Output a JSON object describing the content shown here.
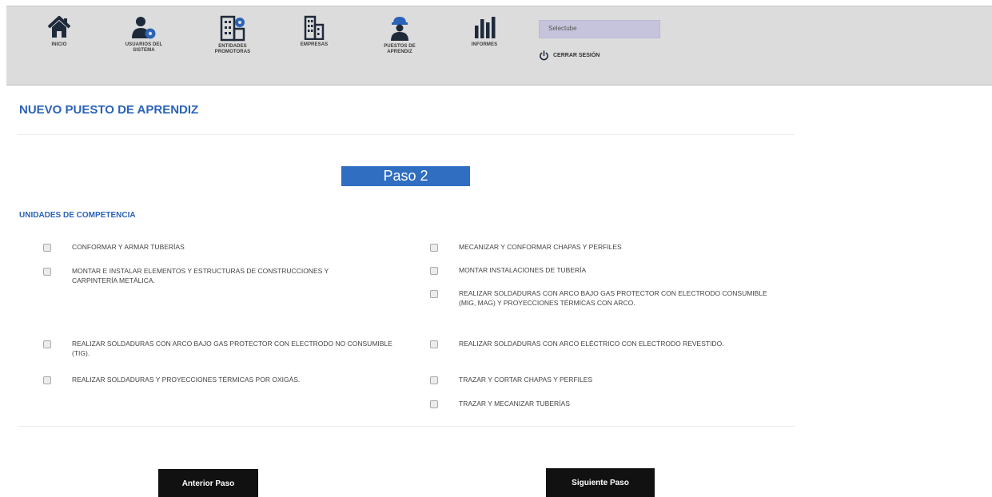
{
  "nav": {
    "items": [
      {
        "id": "inicio",
        "label": "INICIO",
        "icon": "home-icon"
      },
      {
        "id": "usuarios",
        "label": "USUARIOS DEL SISTEMA",
        "icon": "user-gear-icon"
      },
      {
        "id": "entidades",
        "label": "ENTIDADES PROMOTORAS",
        "icon": "building-gear-icon"
      },
      {
        "id": "empresas",
        "label": "EMPRESAS",
        "icon": "buildings-icon"
      },
      {
        "id": "puestos",
        "label": "PUESTOS DE APRENDIZ",
        "icon": "worker-helmet-icon"
      },
      {
        "id": "informes",
        "label": "INFORMES",
        "icon": "bar-chart-icon"
      }
    ],
    "user_select": "Selectube",
    "logout_label": "CERRAR SESIÓN"
  },
  "page": {
    "title": "NUEVO PUESTO DE APRENDIZ",
    "step": "Paso 2",
    "section_title": "UNIDADES DE COMPETENCIA"
  },
  "competencias": [
    {
      "label": "CONFORMAR Y ARMAR TUBERÍAS",
      "checked": false
    },
    {
      "label": "MONTAR E INSTALAR ELEMENTOS Y ESTRUCTURAS DE CONSTRUCCIONES Y CARPINTERÍA METÁLICA.",
      "checked": false
    },
    {
      "label": "REALIZAR SOLDADURAS CON ARCO BAJO GAS PROTECTOR CON ELECTRODO NO CONSUMIBLE (TIG).",
      "checked": false
    },
    {
      "label": "REALIZAR SOLDADURAS Y PROYECCIONES TÉRMICAS POR OXIGÁS.",
      "checked": false
    },
    {
      "label": "MECANIZAR Y CONFORMAR CHAPAS Y PERFILES",
      "checked": false
    },
    {
      "label": "MONTAR INSTALACIONES DE TUBERÍA",
      "checked": false
    },
    {
      "label": "REALIZAR SOLDADURAS CON ARCO BAJO GAS PROTECTOR CON ELECTRODO CONSUMIBLE (MIG, MAG) Y PROYECCIONES TÉRMICAS CON ARCO.",
      "checked": false
    },
    {
      "label": "REALIZAR SOLDADURAS CON ARCO ELÉCTRICO CON ELECTRODO REVESTIDO.",
      "checked": false
    },
    {
      "label": "TRAZAR Y CORTAR CHAPAS Y PERFILES",
      "checked": false
    },
    {
      "label": "TRAZAR Y MECANIZAR TUBERÍAS",
      "checked": false
    }
  ],
  "buttons": {
    "prev": "Anterior Paso",
    "next": "Siguiente Paso"
  },
  "colors": {
    "accent": "#2b63b8",
    "step_bg": "#2f6ec1",
    "nav_bg": "#dcdcdc",
    "button_bg": "#111111"
  }
}
